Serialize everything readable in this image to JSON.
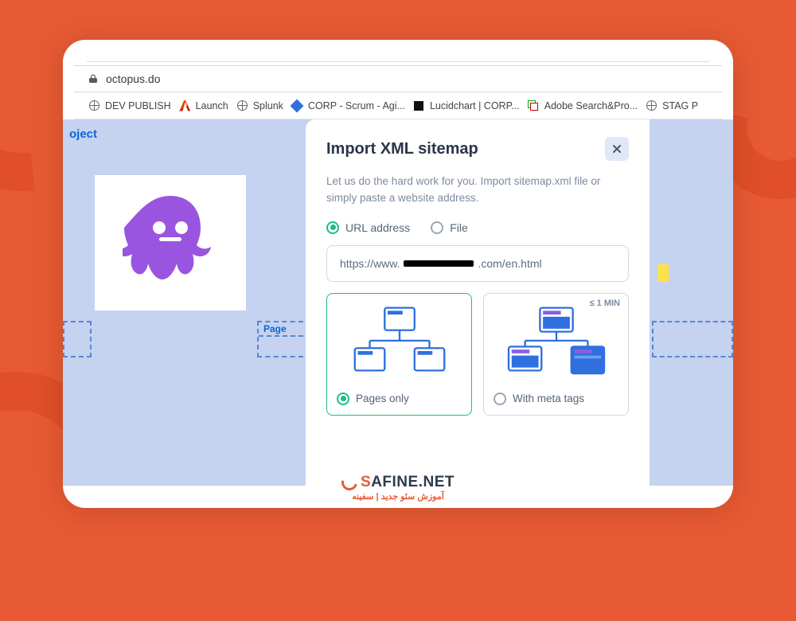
{
  "browser": {
    "url_host": "octopus.do",
    "bookmarks": [
      {
        "label": "DEV PUBLISH",
        "icon": "globe"
      },
      {
        "label": "Launch",
        "icon": "adobe"
      },
      {
        "label": "Splunk",
        "icon": "globe"
      },
      {
        "label": "CORP - Scrum - Agi...",
        "icon": "diamond",
        "color": "#2f6fe0"
      },
      {
        "label": "Lucidchart | CORP...",
        "icon": "square"
      },
      {
        "label": "Adobe Search&Pro...",
        "icon": "layers"
      },
      {
        "label": "STAG P",
        "icon": "globe"
      }
    ]
  },
  "canvas": {
    "project_label": "oject",
    "page_label": "Page"
  },
  "modal": {
    "title": "Import XML sitemap",
    "description": "Let us do the hard work for you. Import sitemap.xml file or simply paste a website address.",
    "source_options": {
      "url": "URL address",
      "file": "File",
      "selected": "url"
    },
    "url_prefix": "https://www.",
    "url_suffix": ".com/en.html",
    "choices": {
      "pages_only": "Pages only",
      "with_meta": "With meta tags",
      "eta": "≤ 1 MIN",
      "selected": "pages_only"
    }
  },
  "brand": {
    "name_colored": "S",
    "name_rest": "AFINE.NET",
    "subtitle": "آموزش سئو جدید | سفینه"
  }
}
